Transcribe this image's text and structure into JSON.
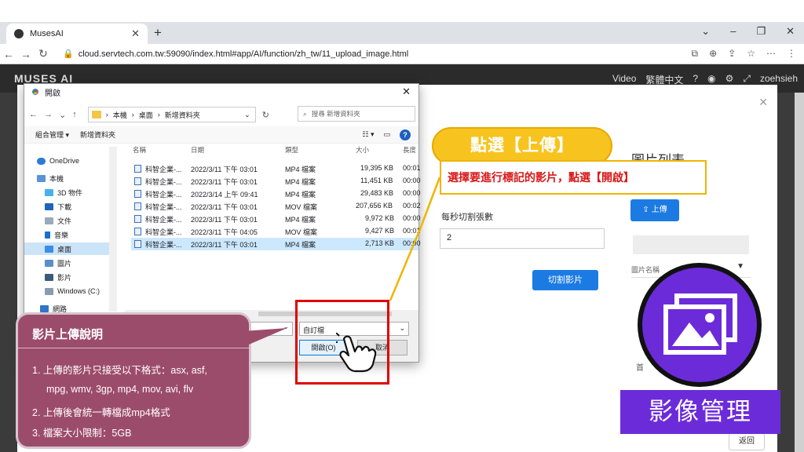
{
  "browser": {
    "tab_title": "MusesAI",
    "url": "cloud.servtech.com.tw:59090/index.html#app/AI/function/zh_tw/11_upload_image.html"
  },
  "app": {
    "logo": "MUSES AI",
    "nav": [
      "Video",
      "繁體中文",
      "zoehsieh"
    ],
    "form_label": "每秒切割張數",
    "form_value": "2",
    "cut_button": "切割影片",
    "panel_title": "圖片列表",
    "upload_button": "上傳",
    "column_header": "圖片名稱",
    "back_button": "返回",
    "partial_text": "首"
  },
  "dialog": {
    "title": "開啟",
    "breadcrumb": [
      "本機",
      "桌面",
      "新增資料夾"
    ],
    "search_placeholder": "搜尋 新增資料夾",
    "toolbar": [
      "組合管理 ▾",
      "新增資料夾"
    ],
    "nav_items": [
      "OneDrive",
      "本機",
      "3D 物件",
      "下載",
      "文件",
      "音樂",
      "桌面",
      "圖片",
      "影片",
      "Windows (C:)",
      "網路"
    ],
    "columns": [
      "名稱",
      "日期",
      "類型",
      "大小",
      "長度"
    ],
    "files": [
      {
        "name": "科智企業-...",
        "date": "2022/3/11 下午 03:01",
        "type": "MP4 檔案",
        "size": "19,395 KB",
        "len": "00:01"
      },
      {
        "name": "科智企業-...",
        "date": "2022/3/11 下午 03:01",
        "type": "MP4 檔案",
        "size": "11,451 KB",
        "len": "00:00"
      },
      {
        "name": "科智企業-...",
        "date": "2022/3/14 上午 09:41",
        "type": "MP4 檔案",
        "size": "29,483 KB",
        "len": "00:00"
      },
      {
        "name": "科智企業-...",
        "date": "2022/3/11 下午 03:01",
        "type": "MOV 檔案",
        "size": "207,656 KB",
        "len": "00:02"
      },
      {
        "name": "科智企業-...",
        "date": "2022/3/11 下午 03:01",
        "type": "MP4 檔案",
        "size": "9,972 KB",
        "len": "00:00"
      },
      {
        "name": "科智企業-...",
        "date": "2022/3/11 下午 04:05",
        "type": "MOV 檔案",
        "size": "9,427 KB",
        "len": "00:01"
      },
      {
        "name": "科智企業-...",
        "date": "2022/3/11 下午 03:01",
        "type": "MP4 檔案",
        "size": "2,713 KB",
        "len": "00:00"
      }
    ],
    "filetype": "自訂檔",
    "open_button": "開啟(O)",
    "cancel_button": "取消"
  },
  "annotations": {
    "pill": "點選【上傳】",
    "note": "選擇要進行標記的影片，點選【開啟】",
    "callout_title": "影片上傳說明",
    "callout_items": [
      "1.  上傳的影片只接受以下格式：asx, asf,",
      "mpg, wmv, 3gp, mp4, mov, avi, flv",
      "2.  上傳後會統一轉檔成mp4格式",
      "3.  檔案大小限制：5GB"
    ],
    "label": "影像管理"
  },
  "colors": {
    "accent_blue": "#1c7be3",
    "callout_bg": "#9c4c6b",
    "purple": "#6c2bd9",
    "highlight_yellow": "#f7c41f",
    "red_box": "#e00000"
  },
  "icons": [
    "chrome-icon",
    "folder-icon",
    "search-icon",
    "help-icon",
    "image-gallery-icon",
    "hand-pointer-icon",
    "lock-icon"
  ]
}
